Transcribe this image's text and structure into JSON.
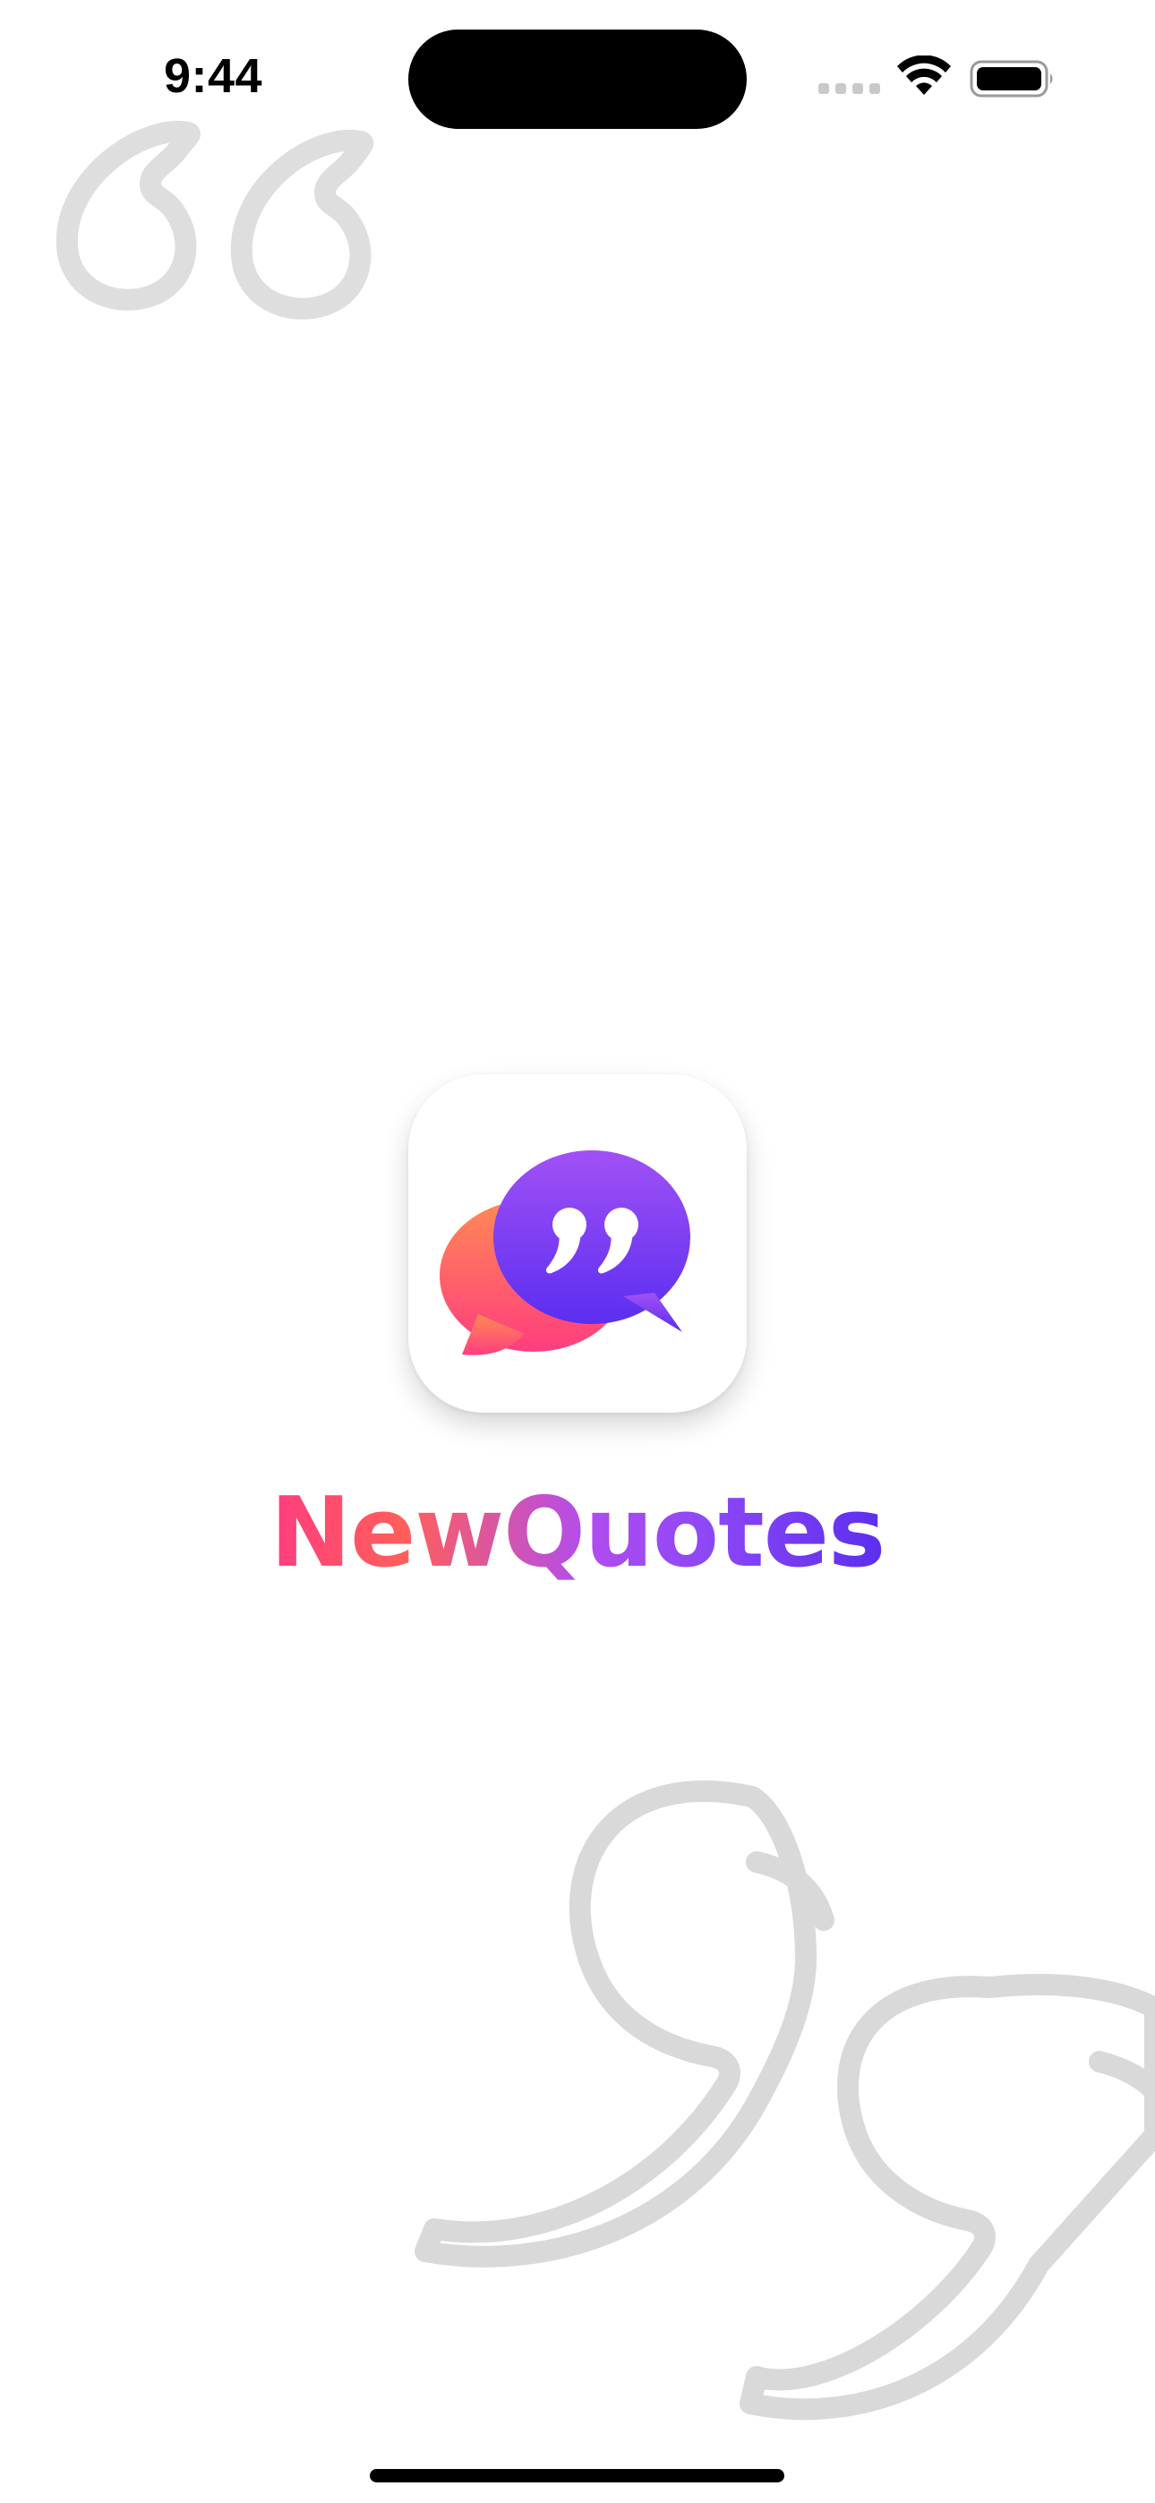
{
  "status_bar": {
    "time": "9:44",
    "icons": [
      "cellular-signal-icon",
      "wifi-icon",
      "battery-icon"
    ]
  },
  "splash": {
    "app_name": "NewQuotes",
    "app_icon": "speech-bubbles-quote-icon",
    "decorations": [
      "open-quote-mark",
      "close-quote-mark"
    ]
  },
  "colors": {
    "background": "#ffffff",
    "decoration_stroke": "#d9d9d9",
    "brand_pink": "#ff3d7f",
    "brand_coral": "#ff5f5a",
    "brand_purple": "#a14cf3",
    "brand_indigo": "#5b2ef0"
  }
}
